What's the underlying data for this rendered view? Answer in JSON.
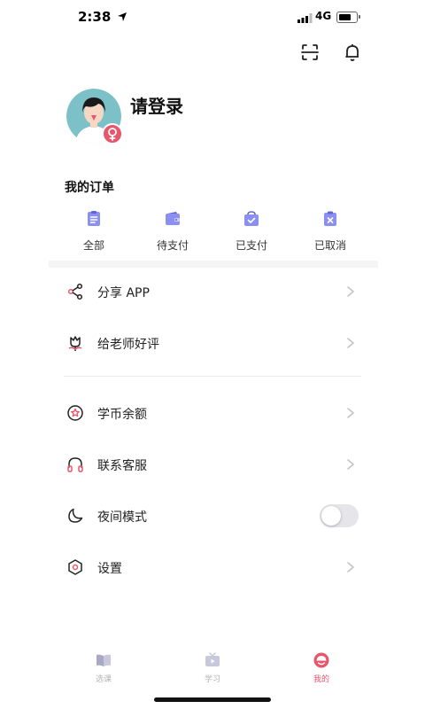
{
  "status_bar": {
    "time": "2:38",
    "network": "4G",
    "battery_level": 0.7
  },
  "top_actions": {
    "scan_icon": "scan-icon",
    "bell_icon": "bell-icon"
  },
  "profile": {
    "login_prompt": "请登录",
    "gender_icon": "female-icon"
  },
  "orders": {
    "title": "我的订单",
    "items": [
      {
        "label": "全部",
        "icon": "list-icon"
      },
      {
        "label": "待支付",
        "icon": "wallet-icon"
      },
      {
        "label": "已支付",
        "icon": "paid-check-icon"
      },
      {
        "label": "已取消",
        "icon": "cancel-x-icon"
      }
    ]
  },
  "menu": {
    "share": "分享 APP",
    "review": "给老师好评",
    "coins": "学币余额",
    "service": "联系客服",
    "night_mode": "夜间模式",
    "settings": "设置",
    "night_mode_enabled": false
  },
  "tabbar": {
    "tabs": [
      {
        "label": "选课",
        "icon": "book-icon",
        "active": false
      },
      {
        "label": "学习",
        "icon": "tv-icon",
        "active": false
      },
      {
        "label": "我的",
        "icon": "profile-face-icon",
        "active": true
      }
    ]
  },
  "colors": {
    "accent": "#e8566c",
    "order_icon": "#8a8ff0",
    "divider": "#ececec"
  }
}
